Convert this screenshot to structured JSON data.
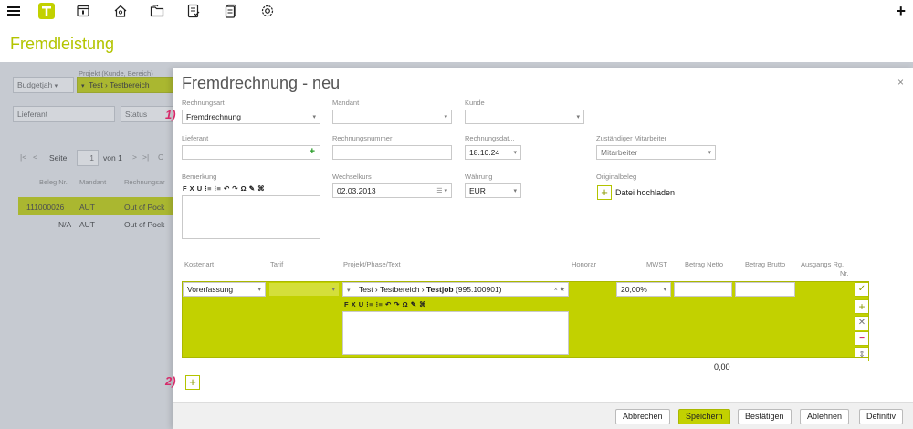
{
  "app": {
    "page_title": "Fremdleistung"
  },
  "background": {
    "budget_select": "Budgetjah",
    "projekt_label": "Projekt (Kunde, Bereich)",
    "projekt_value": "Test › Testbereich",
    "lieferant_placeholder": "Lieferant",
    "status_placeholder": "Status",
    "pager": {
      "first": "|<",
      "prev": "<",
      "seite_label": "Seite",
      "page": "1",
      "of": "von 1",
      "next": ">",
      "last": ">|",
      "refresh": "C"
    },
    "table_headers": [
      "Beleg Nr.",
      "Mandant",
      "Rechnungsar"
    ],
    "rows": [
      {
        "beleg": "111000026",
        "mandant": "AUT",
        "art": "Out of Pock"
      },
      {
        "beleg": "N/A",
        "mandant": "AUT",
        "art": "Out of Pock"
      }
    ]
  },
  "modal": {
    "title": "Fremdrechnung - neu",
    "close": "×",
    "labels": {
      "rechnungsart": "Rechnungsart",
      "mandant": "Mandant",
      "kunde": "Kunde",
      "lieferant": "Lieferant",
      "rechnungsnummer": "Rechnungsnummer",
      "rechnungsdatum": "Rechnungsdat...",
      "mitarbeiter": "Zuständiger Mitarbeiter",
      "bemerkung": "Bemerkung",
      "wechselkurs": "Wechselkurs",
      "waehrung": "Währung",
      "originalbeleg": "Originalbeleg"
    },
    "values": {
      "rechnungsart": "Fremdrechnung",
      "mandant": "",
      "kunde": "",
      "lieferant": "",
      "rechnungsnummer": "",
      "rechnungsdatum": "18.10.24",
      "mitarbeiter_placeholder": "Mitarbeiter",
      "wechselkurs": "02.03.2013",
      "waehrung": "EUR"
    },
    "rte_toolbar": "F X U  ⁝≡ ⁝≡  ↶ ↷ Ω ✎ ⌘",
    "upload_label": "Datei hochladen",
    "markers": {
      "one": "1)",
      "two": "2)"
    },
    "line_headers": {
      "kostenart": "Kostenart",
      "tarif": "Tarif",
      "projekt": "Projekt/Phase/Text",
      "honorar": "Honorar",
      "mwst": "MWST",
      "netto": "Betrag Netto",
      "brutto": "Betrag Brutto",
      "ausgangs1": "Ausgangs Rg.",
      "ausgangs2": "Nr."
    },
    "line": {
      "kostenart": "Vorerfassung",
      "projekt_prefix": "Test › Testbereich › ",
      "projekt_job": "Testjob",
      "projekt_code": " (995.100901)",
      "mwst": "20,00%",
      "netto": "",
      "brutto": ""
    },
    "total": "0,00",
    "buttons": {
      "abbrechen": "Abbrechen",
      "speichern": "Speichern",
      "bestaetigen": "Bestätigen",
      "ablehnen": "Ablehnen",
      "definitiv": "Definitiv"
    }
  },
  "colors": {
    "accent": "#c2d100",
    "marker": "#d62a6a"
  }
}
